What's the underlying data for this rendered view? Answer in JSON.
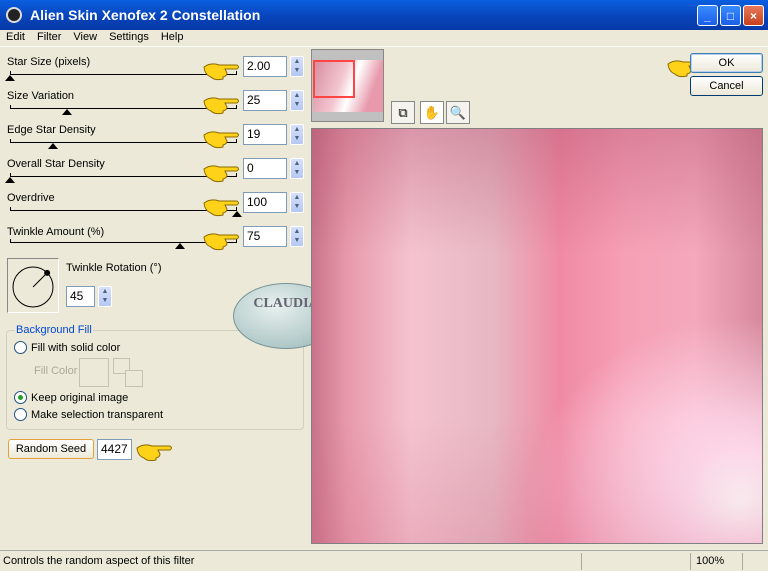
{
  "window": {
    "title": "Alien Skin Xenofex 2 Constellation",
    "minimize": "_",
    "maximize": "□",
    "close": "×"
  },
  "menu": [
    "Edit",
    "Filter",
    "View",
    "Settings",
    "Help"
  ],
  "params": [
    {
      "label": "Star Size (pixels)",
      "value": "2.00",
      "slider_fraction": 0.0
    },
    {
      "label": "Size Variation",
      "value": "25",
      "slider_fraction": 0.25
    },
    {
      "label": "Edge Star Density",
      "value": "19",
      "slider_fraction": 0.19
    },
    {
      "label": "Overall Star Density",
      "value": "0",
      "slider_fraction": 0.0
    },
    {
      "label": "Overdrive",
      "value": "100",
      "slider_fraction": 1.0
    },
    {
      "label": "Twinkle Amount (%)",
      "value": "75",
      "slider_fraction": 0.75
    }
  ],
  "twinkle_rotation": {
    "label": "Twinkle Rotation (°)",
    "value": "45",
    "angle_deg": 45
  },
  "background_fill": {
    "legend": "Background Fill",
    "fill_solid": "Fill with solid color",
    "fill_color_label": "Fill Color",
    "keep_original": "Keep original image",
    "make_transparent": "Make selection transparent",
    "selected": "keep_original"
  },
  "random_seed": {
    "button": "Random Seed",
    "value": "4427"
  },
  "buttons": {
    "ok": "OK",
    "cancel": "Cancel"
  },
  "watermark": "CLAUDIA",
  "status": {
    "text": "Controls the random aspect of this filter",
    "zoom": "100%"
  },
  "colors": {
    "titlebar": "#0842b8",
    "group_legend": "#0046d5",
    "hand_pointer": "#ffd21a"
  }
}
